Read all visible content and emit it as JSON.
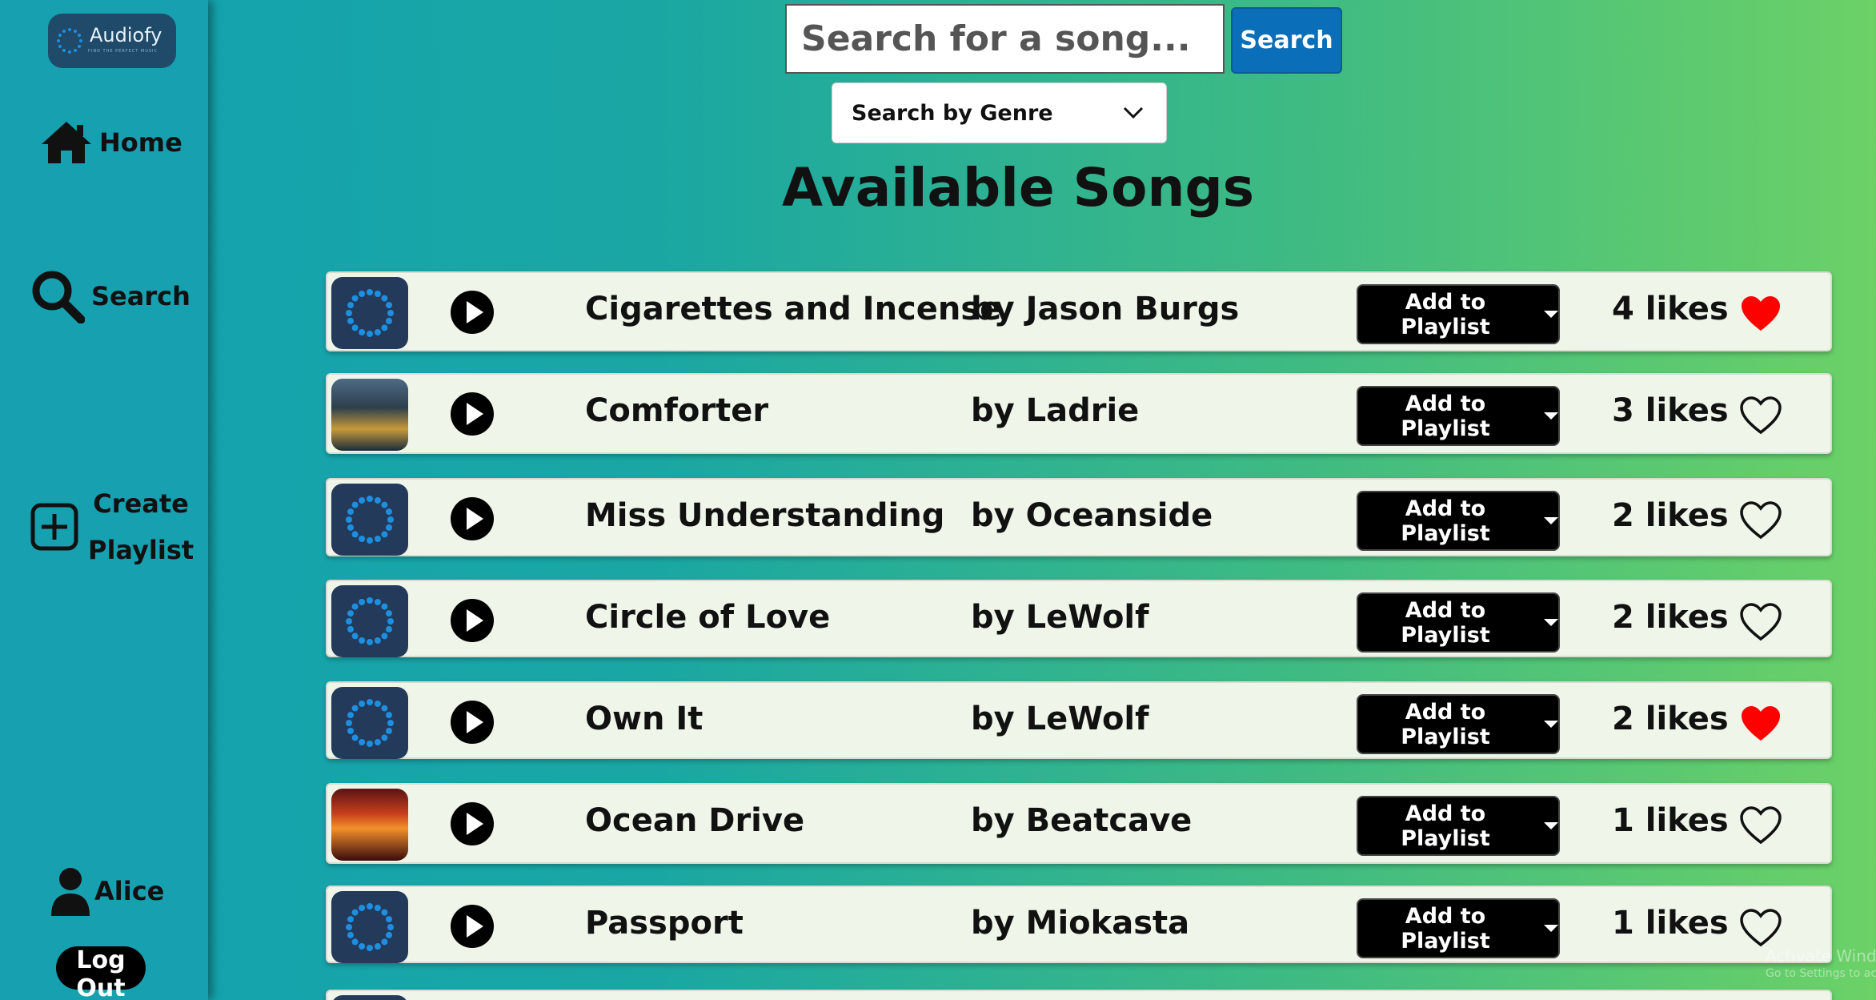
{
  "app": {
    "logo_text": "Audiofy",
    "logo_tagline": "FIND THE PERFECT MUSIC",
    "colors": {
      "sidebar": "#16a0b0",
      "accent": "#0a6fb8",
      "liked": "#ff0000"
    }
  },
  "sidebar": {
    "home_label": "Home",
    "search_label": "Search",
    "create_label_line1": "Create",
    "create_label_line2": "Playlist",
    "user_name": "Alice",
    "logout_label": "Log Out"
  },
  "search": {
    "placeholder": "Search for a song...",
    "button_label": "Search",
    "genre_label": "Search by Genre"
  },
  "main": {
    "title": "Available Songs",
    "add_label": "Add to Playlist",
    "songs": [
      {
        "title": "Cigarettes and Incense",
        "artist": "by Jason Burgs",
        "likes": "4 likes",
        "liked": true,
        "art": "default"
      },
      {
        "title": "Comforter",
        "artist": "by Ladrie",
        "likes": "3 likes",
        "liked": false,
        "art": "comforter"
      },
      {
        "title": "Miss Understanding",
        "artist": "by Oceanside",
        "likes": "2 likes",
        "liked": false,
        "art": "default"
      },
      {
        "title": "Circle of Love",
        "artist": "by LeWolf",
        "likes": "2 likes",
        "liked": false,
        "art": "default"
      },
      {
        "title": "Own It",
        "artist": "by LeWolf",
        "likes": "2 likes",
        "liked": true,
        "art": "default"
      },
      {
        "title": "Ocean Drive",
        "artist": "by Beatcave",
        "likes": "1 likes",
        "liked": false,
        "art": "ocean"
      },
      {
        "title": "Passport",
        "artist": "by Miokasta",
        "likes": "1 likes",
        "liked": false,
        "art": "default"
      }
    ]
  },
  "watermark": {
    "line1": "Activate Windows",
    "line2": "Go to Settings to activate Windows."
  }
}
